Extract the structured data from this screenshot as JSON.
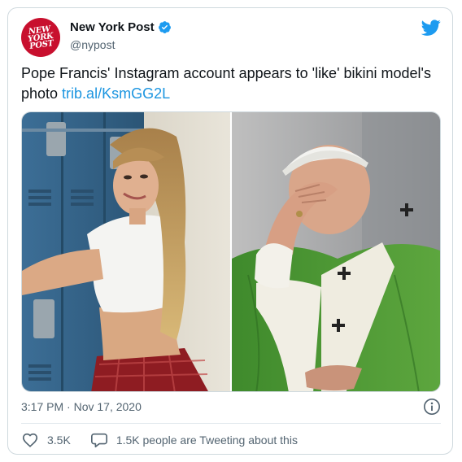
{
  "header": {
    "avatar_text": [
      "NEW",
      "YORK",
      "POST"
    ],
    "display_name": "New York Post",
    "handle": "@nypost"
  },
  "tweet": {
    "text": "Pope Francis' Instagram account appears to 'like' bikini model's photo ",
    "link_text": "trib.al/KsmGG2L"
  },
  "media": {
    "photos": [
      "model-photo",
      "pope-photo"
    ]
  },
  "meta": {
    "timestamp": "3:17 PM · Nov 17, 2020"
  },
  "actions": {
    "likes": "3.5K",
    "conversation": "1.5K people are Tweeting about this"
  },
  "colors": {
    "brand_red": "#c8102e",
    "link_blue": "#1b95e0",
    "twitter_blue": "#1d9bf0",
    "secondary_text": "#536471"
  }
}
